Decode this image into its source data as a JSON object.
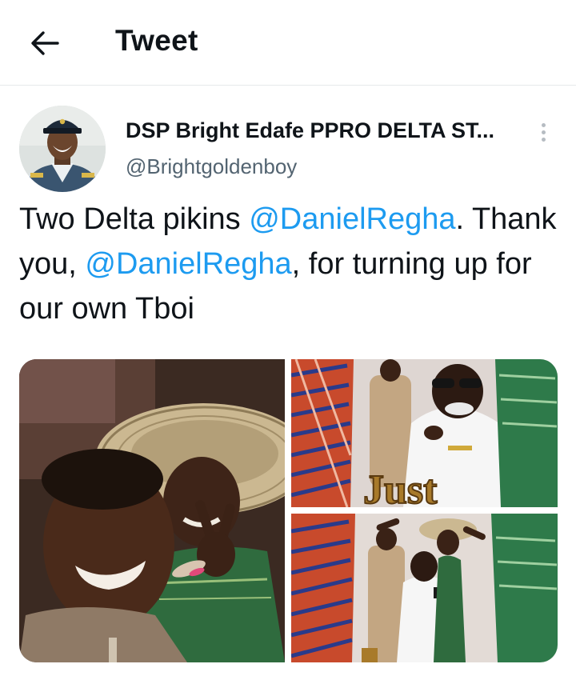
{
  "header": {
    "title": "Tweet",
    "back_icon": "arrow-left-icon"
  },
  "tweet": {
    "author": {
      "name": "DSP Bright Edafe PPRO DELTA ST...",
      "handle": "@Brightgoldenboy",
      "avatar_icon": "police-officer-avatar"
    },
    "more_icon": "vertical-ellipsis-icon",
    "text": {
      "part1": "Two Delta pikins ",
      "mention1": "@DanielRegha",
      "part2": ". Thank you, ",
      "mention2": "@DanielRegha",
      "part3": ", for turning up for our own Tboi"
    },
    "media": {
      "count": 3,
      "photo_texts": [
        "Just"
      ]
    }
  },
  "colors": {
    "text": "#0f1419",
    "secondary": "#536471",
    "link": "#1d9bf0",
    "divider": "#e6e9eb"
  }
}
